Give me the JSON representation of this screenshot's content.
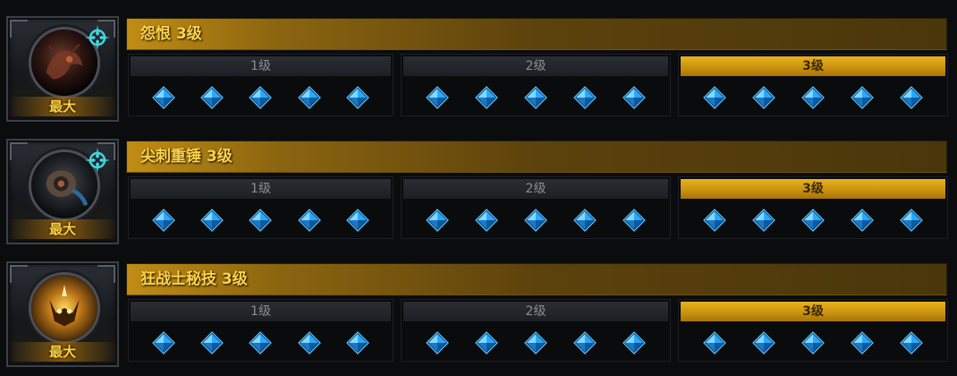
{
  "skills": [
    {
      "name": "怨恨 3级",
      "max_label": "最大",
      "icon": "dark-beast-skill-icon",
      "levels": [
        {
          "label": "1级",
          "active": false,
          "gems": 5
        },
        {
          "label": "2级",
          "active": false,
          "gems": 5
        },
        {
          "label": "3级",
          "active": true,
          "gems": 5
        }
      ]
    },
    {
      "name": "尖刺重锤 3级",
      "max_label": "最大",
      "icon": "spiked-hammer-skill-icon",
      "levels": [
        {
          "label": "1级",
          "active": false,
          "gems": 5
        },
        {
          "label": "2级",
          "active": false,
          "gems": 5
        },
        {
          "label": "3级",
          "active": true,
          "gems": 5
        }
      ]
    },
    {
      "name": "狂战士秘技 3级",
      "max_label": "最大",
      "icon": "berserker-skill-icon",
      "levels": [
        {
          "label": "1级",
          "active": false,
          "gems": 5
        },
        {
          "label": "2级",
          "active": false,
          "gems": 5
        },
        {
          "label": "3级",
          "active": true,
          "gems": 5
        }
      ]
    }
  ],
  "colors": {
    "gold": "#ffd24a",
    "gem_blue": "#2aa8ff",
    "active_level": "#e9b21c",
    "compass_teal": "#3fd6e0"
  }
}
